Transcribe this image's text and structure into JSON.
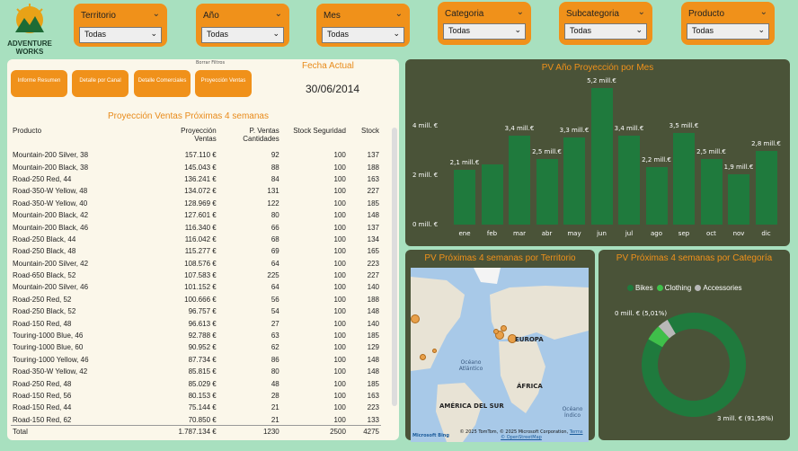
{
  "brand": {
    "name_line1": "ADVENTURE",
    "name_line2": "WORKS"
  },
  "slicers": [
    {
      "label": "Territorio",
      "value": "Todas"
    },
    {
      "label": "Año",
      "value": "Todas"
    },
    {
      "label": "Mes",
      "value": "Todas"
    },
    {
      "label": "Categoria",
      "value": "Todas"
    },
    {
      "label": "Subcategoria",
      "value": "Todas"
    },
    {
      "label": "Producto",
      "value": "Todas"
    }
  ],
  "nav": {
    "hint": "Borrar Filtros",
    "buttons": [
      "Informe Resumen",
      "Detalle por Canal",
      "Detalle Comerciales",
      "Proyección Ventas"
    ]
  },
  "fecha": {
    "label": "Fecha Actual",
    "value": "30/06/2014"
  },
  "table": {
    "title": "Proyección Ventas Próximas 4 semanas",
    "headers": [
      "Producto",
      "Proyección Ventas",
      "P. Ventas Cantidades",
      "Stock Seguridad",
      "Stock"
    ],
    "rows": [
      [
        "Mountain-200 Silver, 38",
        "157.110 €",
        "92",
        "100",
        "137"
      ],
      [
        "Mountain-200 Black, 38",
        "145.043 €",
        "88",
        "100",
        "188"
      ],
      [
        "Road-250 Red, 44",
        "136.241 €",
        "84",
        "100",
        "163"
      ],
      [
        "Road-350-W Yellow, 48",
        "134.072 €",
        "131",
        "100",
        "227"
      ],
      [
        "Road-350-W Yellow, 40",
        "128.969 €",
        "122",
        "100",
        "185"
      ],
      [
        "Mountain-200 Black, 42",
        "127.601 €",
        "80",
        "100",
        "148"
      ],
      [
        "Mountain-200 Black, 46",
        "116.340 €",
        "66",
        "100",
        "137"
      ],
      [
        "Road-250 Black, 44",
        "116.042 €",
        "68",
        "100",
        "134"
      ],
      [
        "Road-250 Black, 48",
        "115.277 €",
        "69",
        "100",
        "165"
      ],
      [
        "Mountain-200 Silver, 42",
        "108.576 €",
        "64",
        "100",
        "223"
      ],
      [
        "Road-650 Black, 52",
        "107.583 €",
        "225",
        "100",
        "227"
      ],
      [
        "Mountain-200 Silver, 46",
        "101.152 €",
        "64",
        "100",
        "140"
      ],
      [
        "Road-250 Red, 52",
        "100.666 €",
        "56",
        "100",
        "188"
      ],
      [
        "Road-250 Black, 52",
        "96.757 €",
        "54",
        "100",
        "148"
      ],
      [
        "Road-150 Red, 48",
        "96.613 €",
        "27",
        "100",
        "140"
      ],
      [
        "Touring-1000 Blue, 46",
        "92.788 €",
        "63",
        "100",
        "185"
      ],
      [
        "Touring-1000 Blue, 60",
        "90.952 €",
        "62",
        "100",
        "129"
      ],
      [
        "Touring-1000 Yellow, 46",
        "87.734 €",
        "86",
        "100",
        "148"
      ],
      [
        "Road-350-W Yellow, 42",
        "85.815 €",
        "80",
        "100",
        "148"
      ],
      [
        "Road-250 Red, 48",
        "85.029 €",
        "48",
        "100",
        "185"
      ],
      [
        "Road-150 Red, 56",
        "80.153 €",
        "28",
        "100",
        "163"
      ],
      [
        "Road-150 Red, 44",
        "75.144 €",
        "21",
        "100",
        "223"
      ],
      [
        "Road-150 Red, 62",
        "70.850 €",
        "21",
        "100",
        "133"
      ]
    ],
    "total": [
      "Total",
      "1.787.134 €",
      "1230",
      "2500",
      "4275"
    ]
  },
  "chart_data": [
    {
      "type": "bar",
      "title": "PV Año Proyección por Mes",
      "categories": [
        "ene",
        "feb",
        "mar",
        "abr",
        "may",
        "jun",
        "jul",
        "ago",
        "sep",
        "oct",
        "nov",
        "dic"
      ],
      "values": [
        2.1,
        2.3,
        3.4,
        2.5,
        3.3,
        5.2,
        3.4,
        2.2,
        3.5,
        2.5,
        1.9,
        2.8
      ],
      "labels": [
        "2,1 mill.€",
        "",
        "3,4 mill.€",
        "2,5 mill.€",
        "3,3 mill.€",
        "5,2 mill.€",
        "3,4 mill.€",
        "2,2 mill.€",
        "3,5 mill.€",
        "2,5 mill.€",
        "1,9 mill.€",
        "2,8 mill.€"
      ],
      "yticks": [
        "0 mill. €",
        "2 mill. €",
        "4 mill. €"
      ],
      "ylim": [
        0,
        5.4
      ],
      "color": "#1f7a3d"
    },
    {
      "type": "pie",
      "title": "PV Próximas 4 semanas por Categoría",
      "categories": [
        "Bikes",
        "Clothing",
        "Accessories"
      ],
      "values": [
        91.58,
        5.01,
        3.41
      ],
      "colors": [
        "#1f7a3d",
        "#3fbf4a",
        "#b8b8b8"
      ],
      "annotations": [
        "0 mill. € (5,01%)",
        "3 mill. € (91,58%)"
      ]
    }
  ],
  "map": {
    "title": "PV Próximas 4 semanas por Territorio",
    "labels": [
      "EUROPA",
      "ÁFRICA",
      "AMÉRICA DEL SUR"
    ],
    "seas": [
      "Océano Atlántico",
      "Océano Índico"
    ],
    "credits_line1": "© 2025 TomTom, © 2025 Microsoft Corporation,",
    "credits_terms": "Terms",
    "credits_line2": "© OpenStreetMap",
    "bing": "Microsoft Bing"
  }
}
